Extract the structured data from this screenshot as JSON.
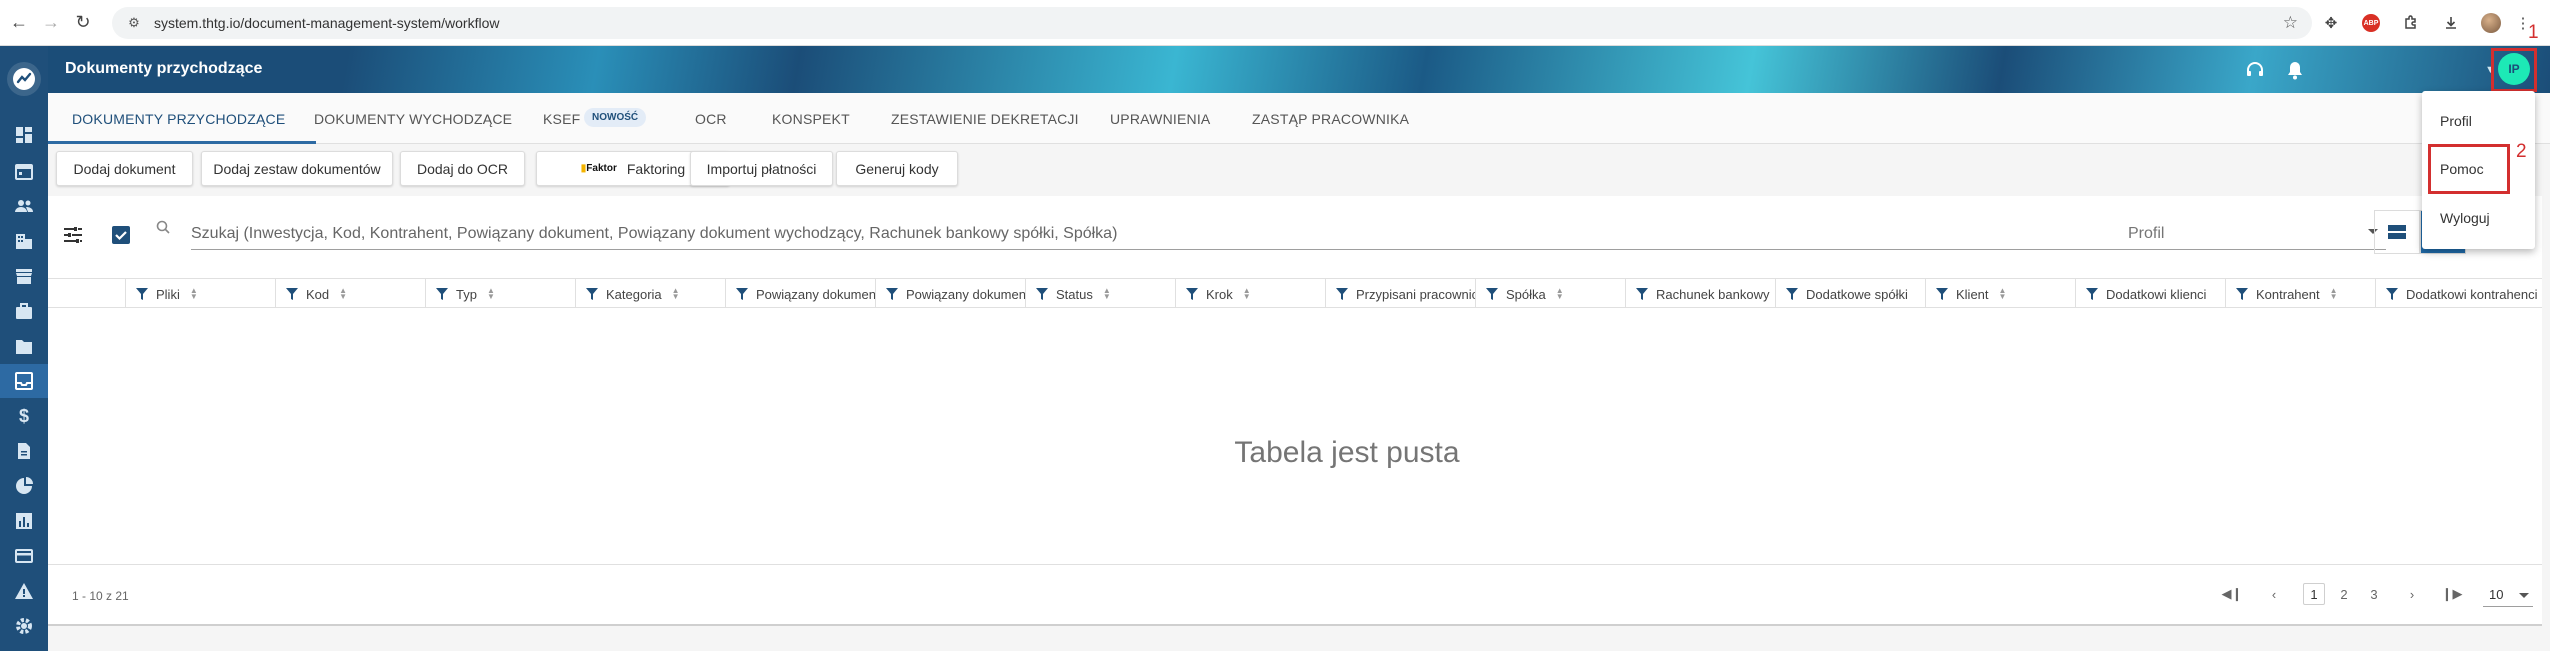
{
  "browser": {
    "url": "system.thtg.io/document-management-system/workflow",
    "ext_badge": "ABP"
  },
  "header": {
    "title": "Dokumenty przychodzące",
    "avatar_initials": "IP"
  },
  "annotations": {
    "marker_1": "1",
    "marker_2": "2"
  },
  "tabs": [
    {
      "label": "DOKUMENTY PRZYCHODZĄCE",
      "active": true
    },
    {
      "label": "DOKUMENTY WYCHODZĄCE"
    },
    {
      "label": "KSEF"
    },
    {
      "label": "OCR"
    },
    {
      "label": "KONSPEKT"
    },
    {
      "label": "ZESTAWIENIE DEKRETACJI"
    },
    {
      "label": "UPRAWNIENIA"
    },
    {
      "label": "ZASTĄP PRACOWNIKA"
    }
  ],
  "ksef_badge": "NOWOŚĆ",
  "toolbar": {
    "add_document": "Dodaj dokument",
    "add_document_set": "Dodaj zestaw dokumentów",
    "add_to_ocr": "Dodaj do OCR",
    "faktor_logo": "Faktor",
    "factoring": "Faktoring",
    "import_payments": "Importuj płatności",
    "generate_codes": "Generuj kody"
  },
  "search": {
    "placeholder": "Szukaj (Inwestycja, Kod, Kontrahent, Powiązany dokument, Powiązany dokument wychodzący, Rachunek bankowy spółki, Spółka)"
  },
  "profile_select": {
    "placeholder": "Profil"
  },
  "columns": [
    "Pliki",
    "Kod",
    "Typ",
    "Kategoria",
    "Powiązany dokument",
    "Powiązany dokument wychodzący",
    "Status",
    "Krok",
    "Przypisani pracownicy",
    "Spółka",
    "Rachunek bankowy",
    "Dodatkowe spółki",
    "Klient",
    "Dodatkowi klienci",
    "Kontrahent",
    "Dodatkowi kontrahenci"
  ],
  "table": {
    "empty_message": "Tabela jest pusta"
  },
  "pagination": {
    "range": "1 - 10 z 21",
    "pages": [
      "1",
      "2",
      "3"
    ],
    "current_page": "1",
    "page_size": "10"
  },
  "dropdown": {
    "items": [
      "Profil",
      "Pomoc",
      "Wyloguj"
    ]
  },
  "colors": {
    "primary": "#1f4f7a",
    "accent": "#1de9b6",
    "highlight": "#d32f2f"
  }
}
